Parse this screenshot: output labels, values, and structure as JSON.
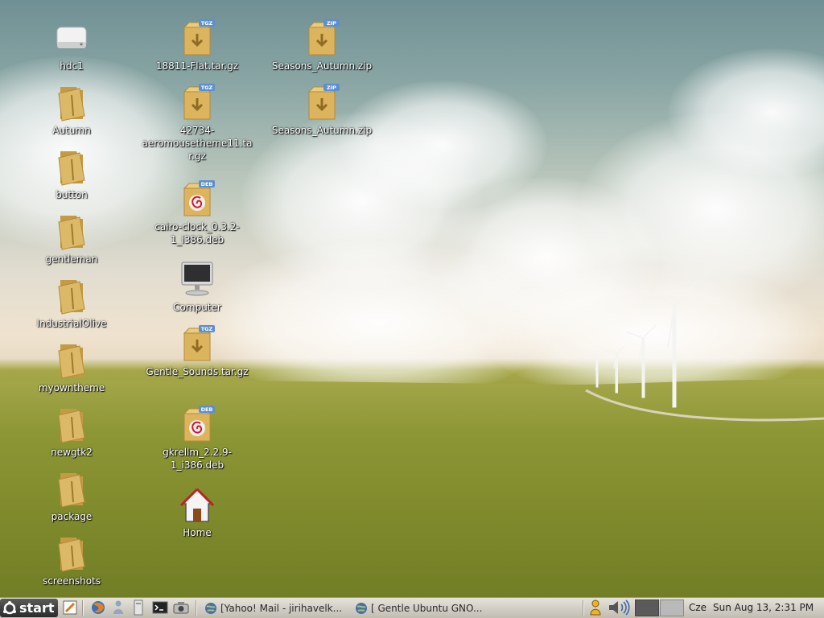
{
  "desktop": {
    "icons_left": [
      {
        "label": "hdc1",
        "type": "drive"
      },
      {
        "label": "Autumn",
        "type": "folder"
      },
      {
        "label": "button",
        "type": "folder"
      },
      {
        "label": "gentleman",
        "type": "folder"
      },
      {
        "label": "IndustrialOlive",
        "type": "folder"
      },
      {
        "label": "myowntheme",
        "type": "folder"
      },
      {
        "label": "newgtk2",
        "type": "folder"
      },
      {
        "label": "package",
        "type": "folder"
      },
      {
        "label": "screenshots",
        "type": "folder"
      }
    ],
    "icons_middle": [
      {
        "label": "18811-Flat.tar.gz",
        "type": "archive",
        "badge": "TGZ"
      },
      {
        "label": "42734-aeromousetheme11.tar.gz",
        "type": "archive",
        "badge": "TGZ"
      },
      {
        "label": "cairo-clock_0.3.2-1_i386.deb",
        "type": "deb",
        "badge": "DEB"
      },
      {
        "label": "Computer",
        "type": "computer"
      },
      {
        "label": "Gentle_Sounds.tar.gz",
        "type": "archive",
        "badge": "TGZ"
      },
      {
        "label": "gkrellm_2.2.9-1_i386.deb",
        "type": "deb",
        "badge": "DEB"
      },
      {
        "label": "Home",
        "type": "home"
      }
    ],
    "icons_right": [
      {
        "label": "Seasons_Autumn.zip",
        "type": "archive",
        "badge": "ZIP"
      },
      {
        "label": "Seasons_Autumn.zip",
        "type": "archive",
        "badge": "ZIP"
      }
    ]
  },
  "taskbar": {
    "start_label": "start",
    "launchers": [
      "text-editor-icon",
      "firefox-icon",
      "messenger-icon",
      "file-manager-icon",
      "terminal-icon",
      "screenshot-icon"
    ],
    "tasks": [
      {
        "label": "[Yahoo! Mail - jirihavelk..."
      },
      {
        "label": "[ Gentle Ubuntu GNO..."
      }
    ],
    "keyboard_layout": "Cze",
    "clock": "Sun Aug 13,  2:31 PM"
  },
  "colors": {
    "sky_top": "#6f9094",
    "grass": "#8c9632",
    "folder": "#d9b25a",
    "taskbar": "#d3cfc6"
  }
}
